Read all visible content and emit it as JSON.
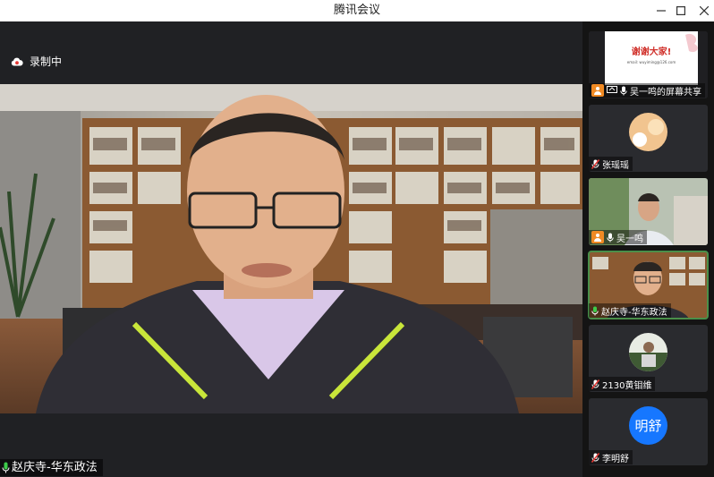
{
  "window": {
    "title": "腾讯会议"
  },
  "recording": {
    "label": "录制中"
  },
  "main_speaker": {
    "name": "赵庆寺-华东政法"
  },
  "participants": [
    {
      "name": "吴一鸣的屏幕共享",
      "slide_title": "谢谢大家!",
      "slide_sub": "email: wuyiming@126.com"
    },
    {
      "name": "张瑶瑶"
    },
    {
      "name": "吴一鸣"
    },
    {
      "name": "赵庆寺-华东政法"
    },
    {
      "name": "2130黄钼维"
    },
    {
      "name": "李明舒",
      "avatar_text": "明舒"
    }
  ],
  "colors": {
    "accent_green": "#4a8f4a",
    "badge_orange": "#f08a24",
    "avatar_blue": "#1677ff"
  }
}
